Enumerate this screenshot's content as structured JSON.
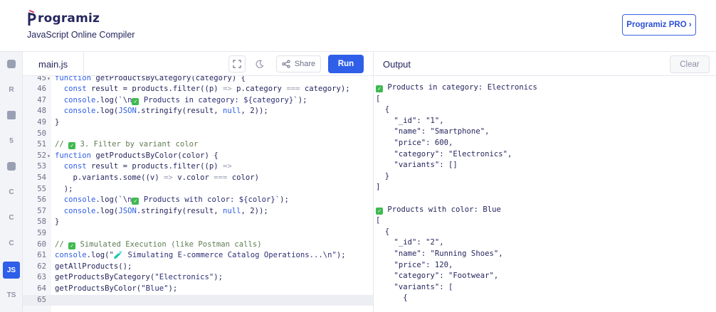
{
  "header": {
    "logo_text": "rogramiz",
    "subtitle": "JavaScript Online Compiler",
    "pro_button": "Programiz PRO ›"
  },
  "sidebar": {
    "languages": [
      {
        "name": "python",
        "icon": "python-icon",
        "label": ""
      },
      {
        "name": "r",
        "icon": "r-icon",
        "label": "R"
      },
      {
        "name": "sql",
        "icon": "database-icon",
        "label": ""
      },
      {
        "name": "html",
        "icon": "html5-icon",
        "label": "5"
      },
      {
        "name": "java",
        "icon": "java-icon",
        "label": ""
      },
      {
        "name": "c",
        "icon": "c-icon",
        "label": "C"
      },
      {
        "name": "cpp",
        "icon": "cpp-icon",
        "label": "C"
      },
      {
        "name": "csharp",
        "icon": "csharp-icon",
        "label": "C"
      },
      {
        "name": "javascript",
        "icon": "js-icon",
        "label": "JS",
        "active": true
      },
      {
        "name": "typescript",
        "icon": "ts-icon",
        "label": "TS"
      }
    ]
  },
  "editor": {
    "tab": "main.js",
    "share_label": "Share",
    "run_label": "Run",
    "current_line": "65",
    "lines": [
      {
        "n": "45",
        "fold": "▾",
        "text": "function getProductsByCategory(category) {"
      },
      {
        "n": "46",
        "fold": "",
        "text": "  const result = products.filter((p) => p.category === category);"
      },
      {
        "n": "47",
        "fold": "",
        "text": "  console.log(`\\n✅ Products in category: ${category}`);"
      },
      {
        "n": "48",
        "fold": "",
        "text": "  console.log(JSON.stringify(result, null, 2));"
      },
      {
        "n": "49",
        "fold": "",
        "text": "}"
      },
      {
        "n": "50",
        "fold": "",
        "text": ""
      },
      {
        "n": "51",
        "fold": "",
        "text": "// ✅ 3. Filter by variant color"
      },
      {
        "n": "52",
        "fold": "▾",
        "text": "function getProductsByColor(color) {"
      },
      {
        "n": "53",
        "fold": "",
        "text": "  const result = products.filter((p) =>"
      },
      {
        "n": "54",
        "fold": "",
        "text": "    p.variants.some((v) => v.color === color)"
      },
      {
        "n": "55",
        "fold": "",
        "text": "  );"
      },
      {
        "n": "56",
        "fold": "",
        "text": "  console.log(`\\n✅ Products with color: ${color}`);"
      },
      {
        "n": "57",
        "fold": "",
        "text": "  console.log(JSON.stringify(result, null, 2));"
      },
      {
        "n": "58",
        "fold": "",
        "text": "}"
      },
      {
        "n": "59",
        "fold": "",
        "text": ""
      },
      {
        "n": "60",
        "fold": "",
        "text": "// ✅ Simulated Execution (like Postman calls)"
      },
      {
        "n": "61",
        "fold": "",
        "text": "console.log(\"🧪 Simulating E-commerce Catalog Operations...\\n\");"
      },
      {
        "n": "62",
        "fold": "",
        "text": "getAllProducts();"
      },
      {
        "n": "63",
        "fold": "",
        "text": "getProductsByCategory(\"Electronics\");"
      },
      {
        "n": "64",
        "fold": "",
        "text": "getProductsByColor(\"Blue\");"
      },
      {
        "n": "65",
        "fold": "",
        "text": ""
      }
    ]
  },
  "output": {
    "label": "Output",
    "clear_label": "Clear",
    "lines": [
      "✅ Products in category: Electronics",
      "[",
      "  {",
      "    \"_id\": \"1\",",
      "    \"name\": \"Smartphone\",",
      "    \"price\": 600,",
      "    \"category\": \"Electronics\",",
      "    \"variants\": []",
      "  }",
      "]",
      "",
      "✅ Products with color: Blue",
      "[",
      "  {",
      "    \"_id\": \"2\",",
      "    \"name\": \"Running Shoes\",",
      "    \"price\": 120,",
      "    \"category\": \"Footwear\",",
      "    \"variants\": [",
      "      {"
    ]
  },
  "colors": {
    "accent": "#2f5ee8",
    "keyword": "#2f5ee8",
    "string": "#2d2f75",
    "comment": "#5f7c53",
    "check": "#3fb950"
  }
}
